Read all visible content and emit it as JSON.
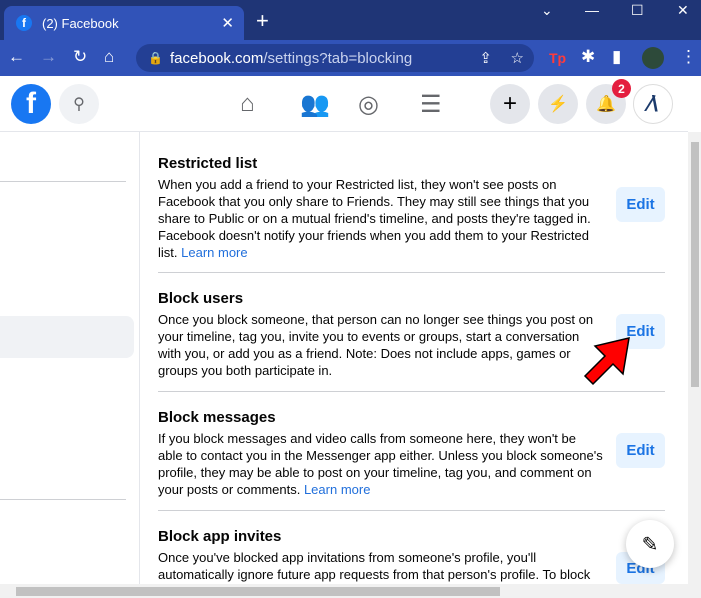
{
  "browser": {
    "tab_title": "(2) Facebook",
    "url_domain": "facebook.com",
    "url_path": "/settings?tab=blocking",
    "extension_label": "Tp"
  },
  "header": {
    "notification_count": "2"
  },
  "sections": [
    {
      "title": "Restricted list",
      "body": "When you add a friend to your Restricted list, they won't see posts on Facebook that you only share to Friends. They may still see things that you share to Public or on a mutual friend's timeline, and posts they're tagged in. Facebook doesn't notify your friends when you add them to your Restricted list.",
      "link": "Learn more",
      "button": "Edit"
    },
    {
      "title": "Block users",
      "body": "Once you block someone, that person can no longer see things you post on your timeline, tag you, invite you to events or groups, start a conversation with you, or add you as a friend. Note: Does not include apps, games or groups you both participate in.",
      "button": "Edit"
    },
    {
      "title": "Block messages",
      "body": "If you block messages and video calls from someone here, they won't be able to contact you in the Messenger app either. Unless you block someone's profile, they may be able to post on your timeline, tag you, and comment on your posts or comments.",
      "link": "Learn more",
      "button": "Edit"
    },
    {
      "title": "Block app invites",
      "body": "Once you've blocked app invitations from someone's profile, you'll automatically ignore future app requests from that person's profile. To block",
      "button": "Edit"
    }
  ],
  "colors": {
    "brand": "#1877f2",
    "edit_bg": "#e7f3ff",
    "edit_text": "#1b74e4",
    "arrow": "#ff0000",
    "browser_tab": "#3153b8"
  }
}
